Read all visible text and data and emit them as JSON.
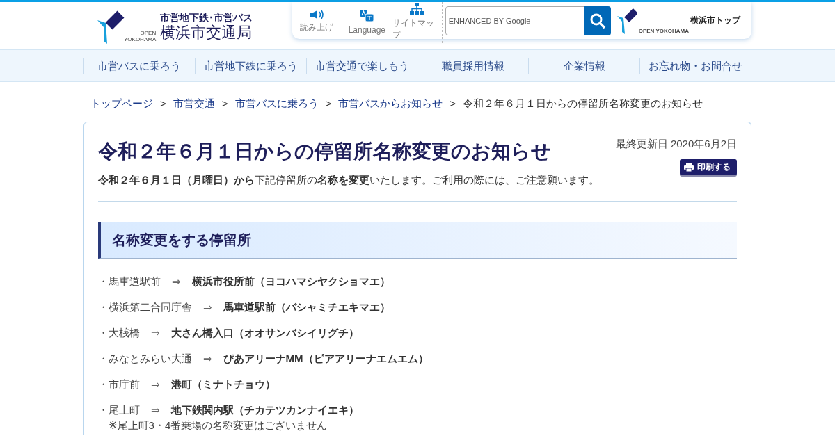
{
  "header": {
    "logo": {
      "tagline_1": "OPEN",
      "tagline_2": "YOKOHAMA",
      "subtitle": "市営地下鉄･市営バス",
      "title": "横浜市交通局"
    },
    "tools": [
      {
        "kind": "speaker",
        "label": "読み上げ"
      },
      {
        "kind": "language",
        "label": "Language"
      },
      {
        "kind": "sitemap",
        "label": "サイトマップ"
      }
    ],
    "search": {
      "placeholder": "ENHANCED BY Google"
    },
    "city_link": {
      "tagline": "OPEN YOKOHAMA",
      "label": "横浜市トップ"
    }
  },
  "nav": [
    "市営バスに乗ろう",
    "市営地下鉄に乗ろう",
    "市営交通で楽しもう",
    "職員採用情報",
    "企業情報",
    "お忘れ物・お問合せ"
  ],
  "breadcrumb": {
    "links": [
      "トップページ",
      "市営交通",
      "市営バスに乗ろう",
      "市営バスからお知らせ"
    ],
    "separator": ">",
    "current": "令和２年６月１日からの停留所名称変更のお知らせ"
  },
  "article": {
    "title": "令和２年６月１日からの停留所名称変更のお知らせ",
    "updated": "最終更新日 2020年6月2日",
    "print_button": "印刷する",
    "lead": "**令和２年６月１日（月曜日）から**下記停留所の**名称を変更**いたします。ご利用の際には、ご注意願います。",
    "section_heading": "名称変更をする停留所",
    "changes": [
      {
        "from": "・馬車道駅前",
        "arrow": "⇒",
        "to": "横浜市役所前（ヨコハマシヤクショマエ）"
      },
      {
        "from": "・横浜第二合同庁舎",
        "arrow": "⇒",
        "to": "馬車道駅前（バシャミチエキマエ）"
      },
      {
        "from": "・大桟橋",
        "arrow": "⇒",
        "to": "大さん橋入口（オオサンバシイリグチ）"
      },
      {
        "from": "・みなとみらい大通",
        "arrow": "⇒",
        "to": "ぴあアリーナMM（ピアアリーナエムエム）"
      },
      {
        "from": "・市庁前",
        "arrow": "⇒",
        "to": "港町（ミナトチョウ）"
      },
      {
        "from": "・尾上町",
        "arrow": "⇒",
        "to": "地下鉄関内駅（チカテツカンナイエキ）",
        "note": "※尾上町3・4番乗場の名称変更はございません"
      }
    ]
  }
}
